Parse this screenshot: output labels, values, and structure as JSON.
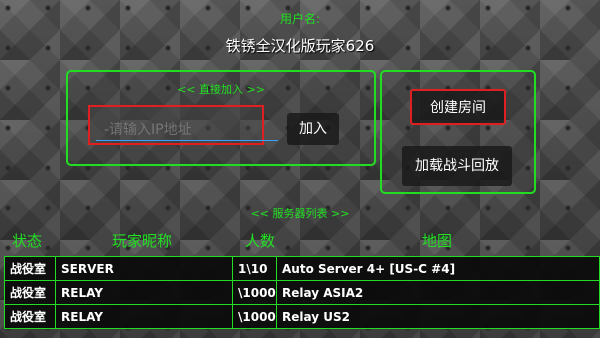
{
  "header": {
    "username_label": "用户名:",
    "player_name": "铁锈全汉化版玩家626"
  },
  "direct_join": {
    "title": "<< 直接加入 >>",
    "ip_placeholder": "-请输入IP地址",
    "join_label": "加入"
  },
  "side_actions": {
    "create_room": "创建房间",
    "load_replay": "加载战斗回放"
  },
  "server_list": {
    "title": "<< 服务器列表 >>",
    "columns": [
      "状态",
      "玩家昵称",
      "人数",
      "地图"
    ],
    "rows": [
      {
        "status": "战役室",
        "name": "SERVER",
        "count": "1\\10",
        "map": "Auto Server 4+ [US-C #4]"
      },
      {
        "status": "战役室",
        "name": "RELAY",
        "count": "\\1000",
        "map": "Relay ASIA2"
      },
      {
        "status": "战役室",
        "name": "RELAY",
        "count": "\\1000",
        "map": "Relay US2"
      }
    ]
  },
  "colors": {
    "accent_green": "#22dd22",
    "highlight_red": "#e02020",
    "input_underline": "#38a0ff"
  }
}
